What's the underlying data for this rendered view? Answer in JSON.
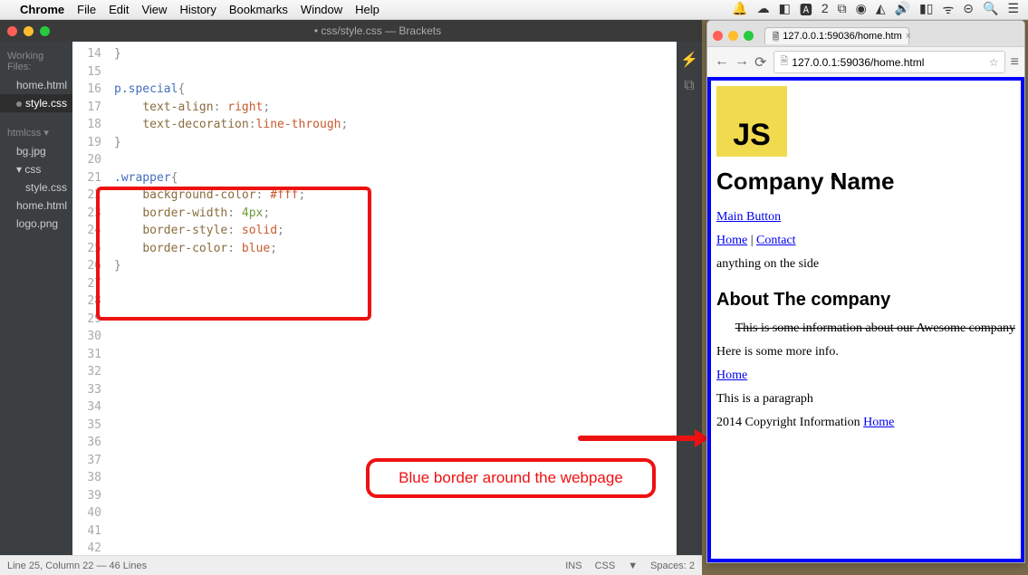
{
  "menubar": {
    "app": "Chrome",
    "items": [
      "File",
      "Edit",
      "View",
      "History",
      "Bookmarks",
      "Window",
      "Help"
    ]
  },
  "brackets": {
    "title": "• css/style.css — Brackets",
    "working_label": "Working Files:",
    "working_files": [
      {
        "name": "home.html",
        "active": false
      },
      {
        "name": "style.css",
        "active": true
      }
    ],
    "project_label": "htmlcss ▾",
    "tree": [
      "bg.jpg",
      "css",
      "style.css",
      "home.html",
      "logo.png"
    ],
    "line_start": 14,
    "code_lines": [
      "}",
      "",
      "p.special{",
      "    text-align: right;",
      "    text-decoration:line-through;",
      "}",
      "",
      ".wrapper{",
      "    background-color: #fff;",
      "    border-width: 4px;",
      "    border-style: solid;",
      "    border-color: blue;",
      "}",
      "",
      "",
      "",
      "",
      "",
      "",
      "",
      "",
      "",
      "",
      "",
      "",
      "",
      "",
      "",
      "",
      ""
    ],
    "status_left": "Line 25, Column 22 — 46 Lines",
    "status_right": [
      "INS",
      "CSS",
      "▼",
      "Spaces: 2"
    ]
  },
  "annotation": {
    "text": "Blue border around the webpage"
  },
  "chrome": {
    "tab_title": "127.0.0.1:59036/home.htm",
    "url": "127.0.0.1:59036/home.html"
  },
  "page": {
    "logo": "JS",
    "company": "Company Name",
    "main_button": "Main Button",
    "nav_home": "Home",
    "nav_sep": " | ",
    "nav_contact": "Contact",
    "side": "anything on the side",
    "about_h": "About The company",
    "special": "This is some information about our Awesome company",
    "more": "Here is some more info.",
    "link_home": "Home",
    "para": "This is a paragraph",
    "footer_pre": "2014 Copyright Information ",
    "footer_link": "Home"
  }
}
